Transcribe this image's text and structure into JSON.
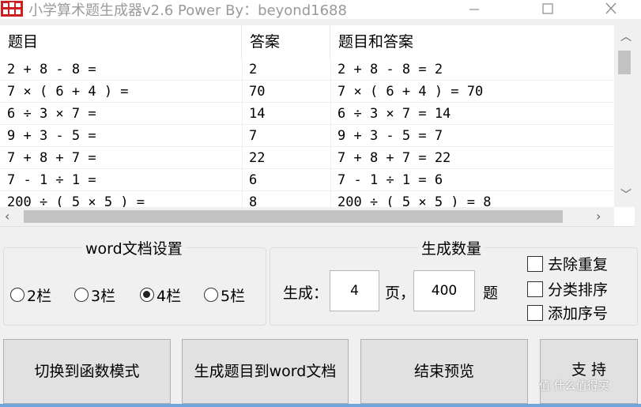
{
  "window": {
    "title": "小学算术题生成器v2.6  Power By：beyond1688",
    "minimize_icon": "minimize-icon",
    "maximize_icon": "maximize-icon",
    "close_icon": "close-icon"
  },
  "grid": {
    "columns": [
      "题目",
      "答案",
      "题目和答案"
    ],
    "rows": [
      {
        "q": "2 + 8 - 8 =",
        "a": "2",
        "qa": "2 + 8 - 8 = 2"
      },
      {
        "q": "7 × ( 6 + 4 ) =",
        "a": "70",
        "qa": "7 × ( 6 + 4 ) = 70"
      },
      {
        "q": "6 ÷ 3 × 7 =",
        "a": "14",
        "qa": "6 ÷ 3 × 7 = 14"
      },
      {
        "q": "9 + 3 - 5 =",
        "a": "7",
        "qa": "9 + 3 - 5 = 7"
      },
      {
        "q": "7 + 8 + 7 =",
        "a": "22",
        "qa": "7 + 8 + 7 = 22"
      },
      {
        "q": "7 - 1 ÷ 1 =",
        "a": "6",
        "qa": "7 - 1 ÷ 1 = 6"
      },
      {
        "q": "200 ÷ ( 5 × 5 ) =",
        "a": "8",
        "qa": "200 ÷ ( 5 × 5 ) = 8"
      }
    ]
  },
  "word_settings": {
    "title": "word文档设置",
    "options": [
      "2栏",
      "3栏",
      "4栏",
      "5栏"
    ],
    "selected": "4栏"
  },
  "quantity": {
    "title": "生成数量",
    "prefix": "生成：",
    "pages": "4",
    "pages_unit": "页，",
    "count": "400",
    "count_unit": "题"
  },
  "checkboxes": [
    {
      "label": "去除重复",
      "checked": false
    },
    {
      "label": "分类排序",
      "checked": false
    },
    {
      "label": "添加序号",
      "checked": false
    }
  ],
  "buttons": {
    "switch_mode": "切换到函数模式",
    "generate_word": "生成题目到word文档",
    "end_preview": "结束预览",
    "support": "支 持"
  },
  "watermark": "值 什么值得买",
  "colors": {
    "app_icon": "#cc1f1f",
    "accent_bar": "#6ea6dc"
  }
}
